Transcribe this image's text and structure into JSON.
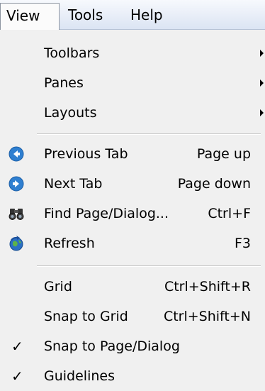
{
  "menubar": {
    "items": [
      {
        "label": "View"
      },
      {
        "label": "Tools"
      },
      {
        "label": "Help"
      }
    ]
  },
  "dropdown": {
    "submenus": [
      {
        "label": "Toolbars"
      },
      {
        "label": "Panes"
      },
      {
        "label": "Layouts"
      }
    ],
    "nav": [
      {
        "label": "Previous Tab",
        "shortcut": "Page up",
        "icon": "previous-tab-icon"
      },
      {
        "label": "Next Tab",
        "shortcut": "Page down",
        "icon": "next-tab-icon"
      },
      {
        "label": "Find Page/Dialog...",
        "shortcut": "Ctrl+F",
        "icon": "binoculars-icon"
      },
      {
        "label": "Refresh",
        "shortcut": "F3",
        "icon": "refresh-globe-icon"
      }
    ],
    "grid": [
      {
        "label": "Grid",
        "shortcut": "Ctrl+Shift+R",
        "checked": false
      },
      {
        "label": "Snap to Grid",
        "shortcut": "Ctrl+Shift+N",
        "checked": false
      },
      {
        "label": "Snap to Page/Dialog",
        "shortcut": "",
        "checked": true
      },
      {
        "label": "Guidelines",
        "shortcut": "",
        "checked": true
      }
    ],
    "check_glyph": "✓"
  },
  "colors": {
    "icon_blue": "#2f7fd0",
    "menu_bg": "#f0f0f0"
  }
}
